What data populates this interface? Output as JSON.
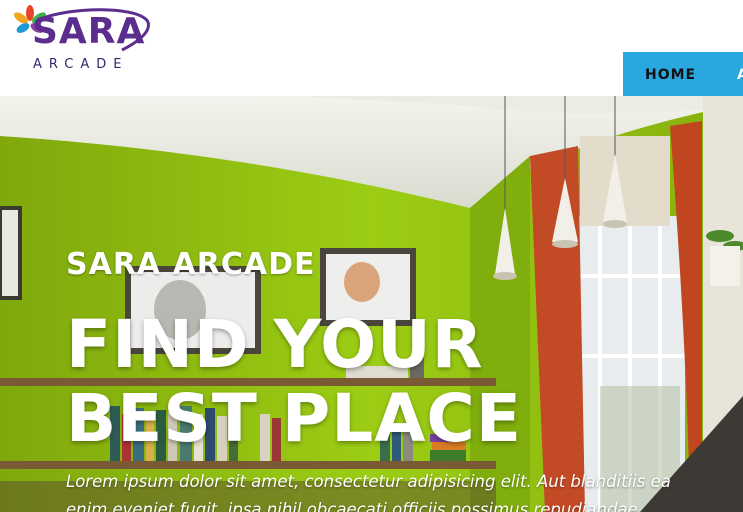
{
  "brand": {
    "name": "SARA",
    "tagline": "ARCADE"
  },
  "nav": {
    "items": [
      {
        "label": "HOME"
      },
      {
        "label": "A"
      }
    ]
  },
  "hero": {
    "subtitle": "SARA ARCADE",
    "title": "FIND YOUR BEST PLACE",
    "text_line1": "Lorem ipsum dolor sit amet, consectetur adipisicing elit. Aut blanditiis ea",
    "text_line2": "enim eveniet fugit, ipsa nihil obcaecati officiis possimus repudiandae"
  },
  "colors": {
    "nav_bg": "#29a8e0",
    "brand_purple": "#5b2d8c",
    "wall_green": "#8fbd10"
  }
}
